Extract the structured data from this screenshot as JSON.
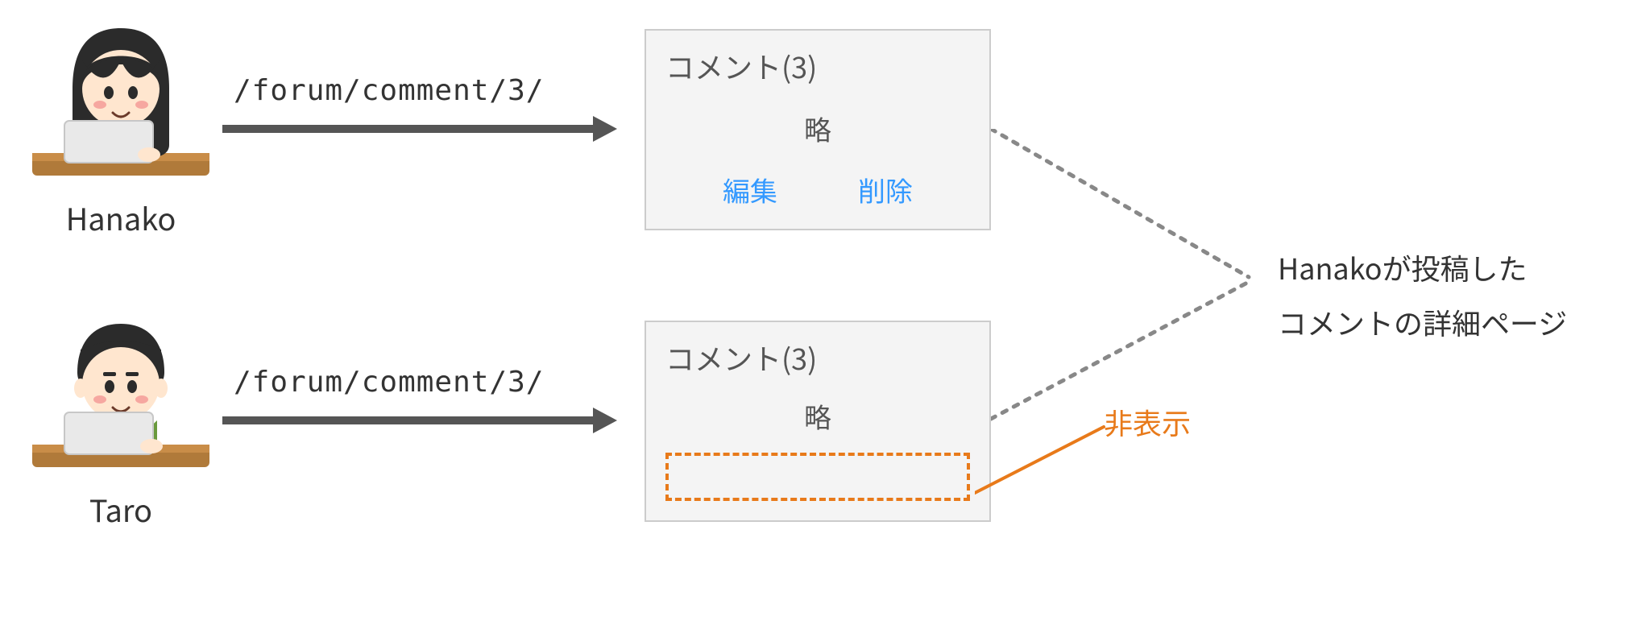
{
  "users": {
    "hanako": {
      "name": "Hanako"
    },
    "taro": {
      "name": "Taro"
    }
  },
  "request": {
    "path": "/forum/comment/3/"
  },
  "cards": {
    "owner_view": {
      "title": "コメント(3)",
      "body": "略",
      "actions": {
        "edit": "編集",
        "delete": "削除"
      }
    },
    "other_view": {
      "title": "コメント(3)",
      "body": "略"
    }
  },
  "annotation": {
    "line1": "Hanakoが投稿した",
    "line2": "コメントの詳細ページ"
  },
  "hidden_label": "非表示"
}
